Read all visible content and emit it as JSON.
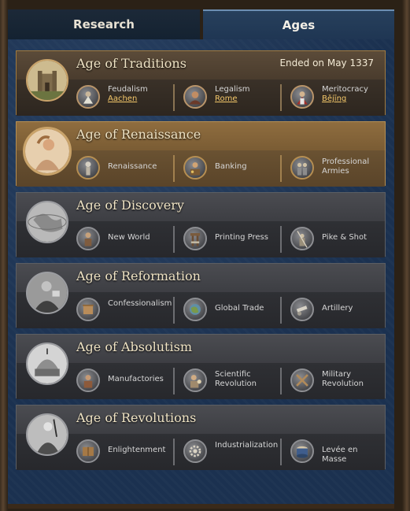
{
  "tabs": [
    {
      "label": "Research",
      "active": false
    },
    {
      "label": "Ages",
      "active": true
    }
  ],
  "ages": [
    {
      "title": "Age of Traditions",
      "status": "Ended on May 1337",
      "state": "completed",
      "portrait": "castle-icon",
      "objectives": [
        {
          "label": "Feudalism",
          "city": "Aachen",
          "icon": "monk-icon"
        },
        {
          "label": "Legalism",
          "city": "Rome",
          "icon": "scholar-icon"
        },
        {
          "label": "Meritocracy",
          "city": "Bějīng",
          "icon": "official-icon"
        }
      ]
    },
    {
      "title": "Age of Renaissance",
      "status": "",
      "state": "current",
      "portrait": "renaissance-figure-icon",
      "objectives": [
        {
          "label": "Renaissance",
          "icon": "statue-icon"
        },
        {
          "label": "Banking",
          "icon": "banker-icon"
        },
        {
          "label": "Professional Armies",
          "icon": "soldiers-icon"
        }
      ]
    },
    {
      "title": "Age of Discovery",
      "status": "",
      "state": "future",
      "portrait": "globe-icon",
      "objectives": [
        {
          "label": "New World",
          "icon": "explorer-icon"
        },
        {
          "label": "Printing Press",
          "icon": "press-icon"
        },
        {
          "label": "Pike & Shot",
          "icon": "pikeman-icon"
        }
      ]
    },
    {
      "title": "Age of Reformation",
      "status": "",
      "state": "future",
      "portrait": "preacher-icon",
      "objectives": [
        {
          "label": "Confessionalism",
          "icon": "scroll-icon"
        },
        {
          "label": "Global Trade",
          "icon": "world-trade-icon"
        },
        {
          "label": "Artillery",
          "icon": "cannon-icon"
        }
      ]
    },
    {
      "title": "Age of Absolutism",
      "status": "",
      "state": "future",
      "portrait": "dome-icon",
      "objectives": [
        {
          "label": "Manufactories",
          "icon": "workshop-icon"
        },
        {
          "label": "Scientific Revolution",
          "icon": "scientist-icon"
        },
        {
          "label": "Military Revolution",
          "icon": "crossed-muskets-icon"
        }
      ]
    },
    {
      "title": "Age of Revolutions",
      "status": "",
      "state": "future",
      "portrait": "revolutionary-icon",
      "objectives": [
        {
          "label": "Enlightenment",
          "icon": "book-icon"
        },
        {
          "label": "Industrialization",
          "icon": "gear-icon"
        },
        {
          "label": "Levée en Masse",
          "icon": "drum-icon"
        }
      ]
    }
  ]
}
